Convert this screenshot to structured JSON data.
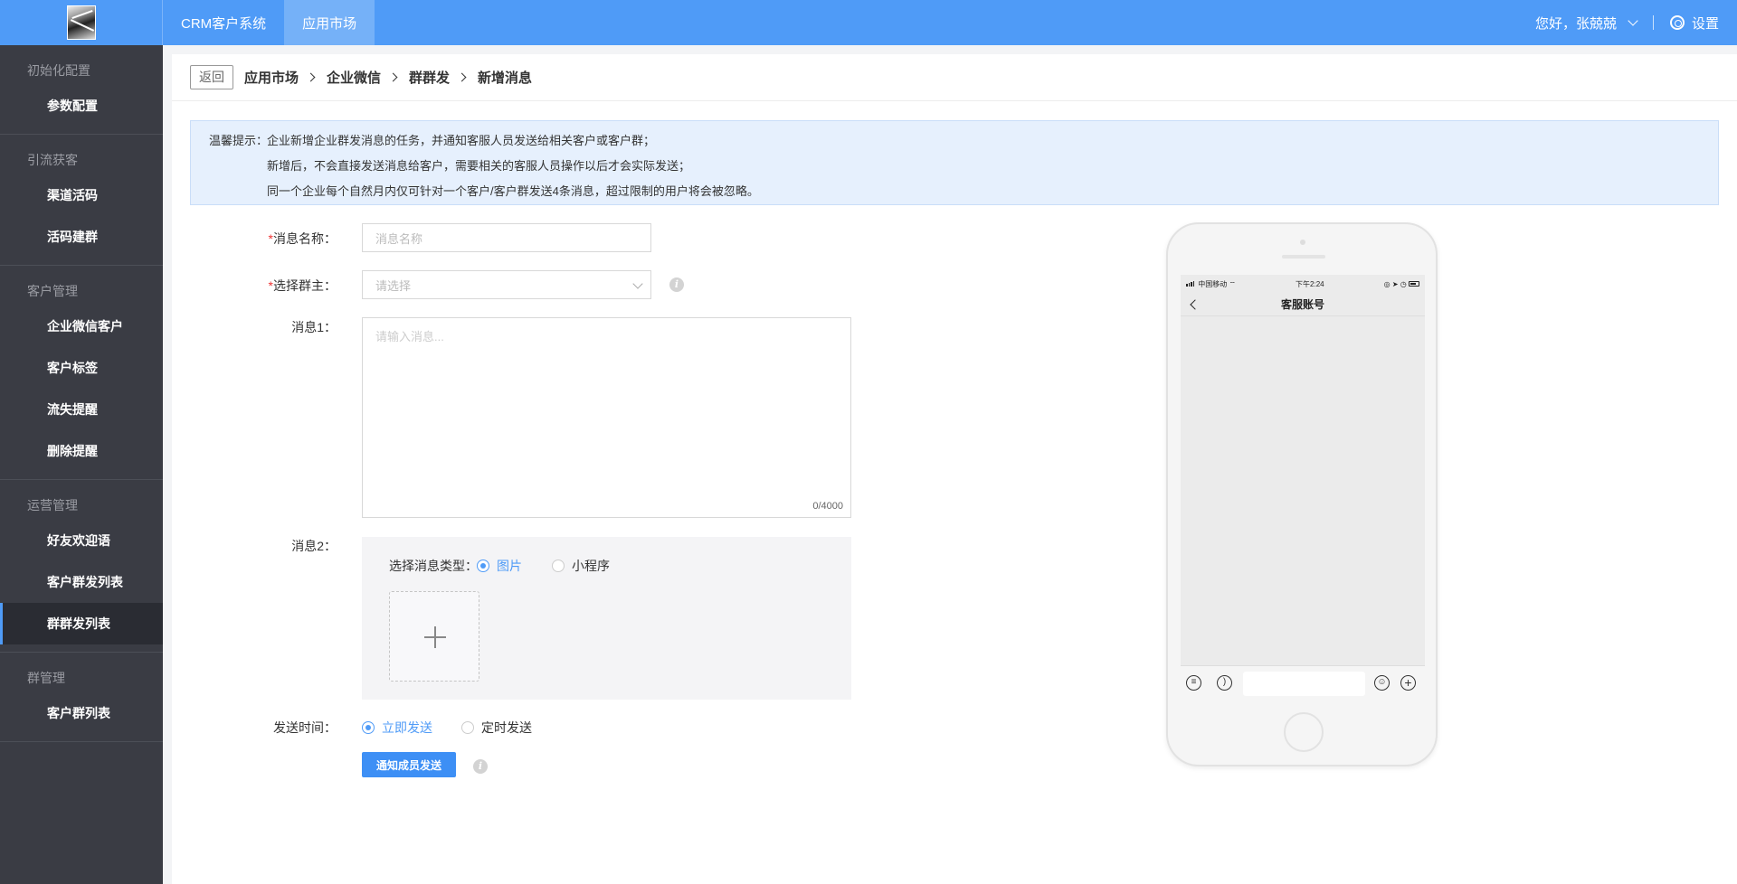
{
  "topbar": {
    "nav": [
      {
        "label": "CRM客户系统",
        "active": false
      },
      {
        "label": "应用市场",
        "active": true
      }
    ],
    "greeting": "您好，张兢兢",
    "settings_label": "设置"
  },
  "sidebar": {
    "groups": [
      {
        "title": "初始化配置",
        "items": [
          {
            "label": "参数配置"
          }
        ]
      },
      {
        "title": "引流获客",
        "items": [
          {
            "label": "渠道活码"
          },
          {
            "label": "活码建群"
          }
        ]
      },
      {
        "title": "客户管理",
        "items": [
          {
            "label": "企业微信客户"
          },
          {
            "label": "客户标签"
          },
          {
            "label": "流失提醒"
          },
          {
            "label": "删除提醒"
          }
        ]
      },
      {
        "title": "运营管理",
        "items": [
          {
            "label": "好友欢迎语"
          },
          {
            "label": "客户群发列表"
          },
          {
            "label": "群群发列表",
            "active": true
          }
        ]
      },
      {
        "title": "群管理",
        "items": [
          {
            "label": "客户群列表"
          }
        ]
      }
    ]
  },
  "breadcrumb": {
    "back_label": "返回",
    "items": [
      "应用市场",
      "企业微信",
      "群群发",
      "新增消息"
    ]
  },
  "notice": {
    "label": "温馨提示：",
    "lines": [
      "企业新增企业群发消息的任务，并通知客服人员发送给相关客户或客户群；",
      "新增后，不会直接发送消息给客户，需要相关的客服人员操作以后才会实际发送；",
      "同一个企业每个自然月内仅可针对一个客户/客户群发送4条消息，超过限制的用户将会被忽略。"
    ]
  },
  "form": {
    "name_label": "消息名称：",
    "name_placeholder": "消息名称",
    "owner_label": "选择群主：",
    "owner_placeholder": "请选择",
    "msg1_label": "消息1：",
    "msg1_placeholder": "请输入消息...",
    "msg1_count": "0/4000",
    "msg2_label": "消息2：",
    "msg2_type_label": "选择消息类型：",
    "msg2_types": [
      {
        "label": "图片",
        "selected": true
      },
      {
        "label": "小程序",
        "selected": false
      }
    ],
    "send_time_label": "发送时间：",
    "send_options": [
      {
        "label": "立即发送",
        "selected": true
      },
      {
        "label": "定时发送",
        "selected": false
      }
    ],
    "submit_label": "通知成员发送",
    "required_mark": "*",
    "info_glyph": "i"
  },
  "phone": {
    "carrier": "中国移动",
    "time": "下午2:24",
    "chat_title": "客服账号"
  },
  "colors": {
    "primary": "#4f9bf7",
    "sidebar_bg": "#3a3c44",
    "required": "#e33333"
  }
}
